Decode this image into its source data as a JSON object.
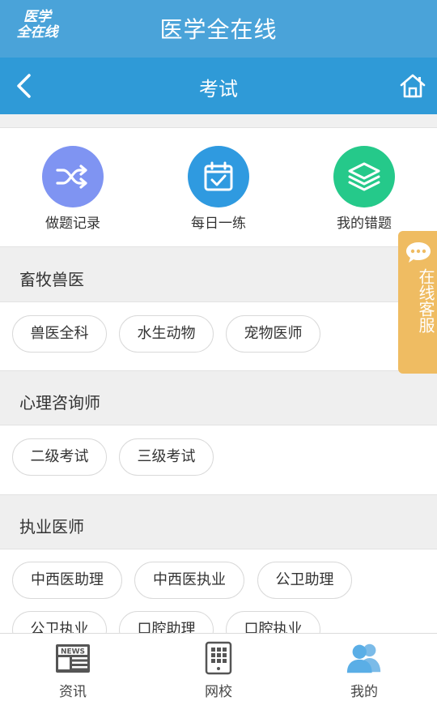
{
  "app": {
    "logo_line1": "医学",
    "logo_line2": "全在线",
    "title": "医学全在线"
  },
  "nav": {
    "title": "考试"
  },
  "quick_actions": [
    {
      "label": "做题记录",
      "icon": "shuffle-icon",
      "color": "#7f94f2"
    },
    {
      "label": "每日一练",
      "icon": "calendar-check-icon",
      "color": "#2f9ae0"
    },
    {
      "label": "我的错题",
      "icon": "layers-icon",
      "color": "#25c98a"
    }
  ],
  "sections": [
    {
      "title": "畜牧兽医",
      "chips": [
        "兽医全科",
        "水生动物",
        "宠物医师"
      ]
    },
    {
      "title": "心理咨询师",
      "chips": [
        "二级考试",
        "三级考试"
      ]
    },
    {
      "title": "执业医师",
      "chips": [
        "中西医助理",
        "中西医执业",
        "公卫助理",
        "公卫执业",
        "口腔助理",
        "口腔执业"
      ]
    }
  ],
  "float_service": {
    "label": "在线客服",
    "color": "#efbc62"
  },
  "tabbar": [
    {
      "label": "资讯",
      "icon": "news-icon"
    },
    {
      "label": "网校",
      "icon": "grid-tablet-icon"
    },
    {
      "label": "我的",
      "icon": "users-icon",
      "color": "#5aaee6"
    }
  ],
  "colors": {
    "brand_bar": "#4aa3d9",
    "nav_bar": "#2f9ad7"
  }
}
